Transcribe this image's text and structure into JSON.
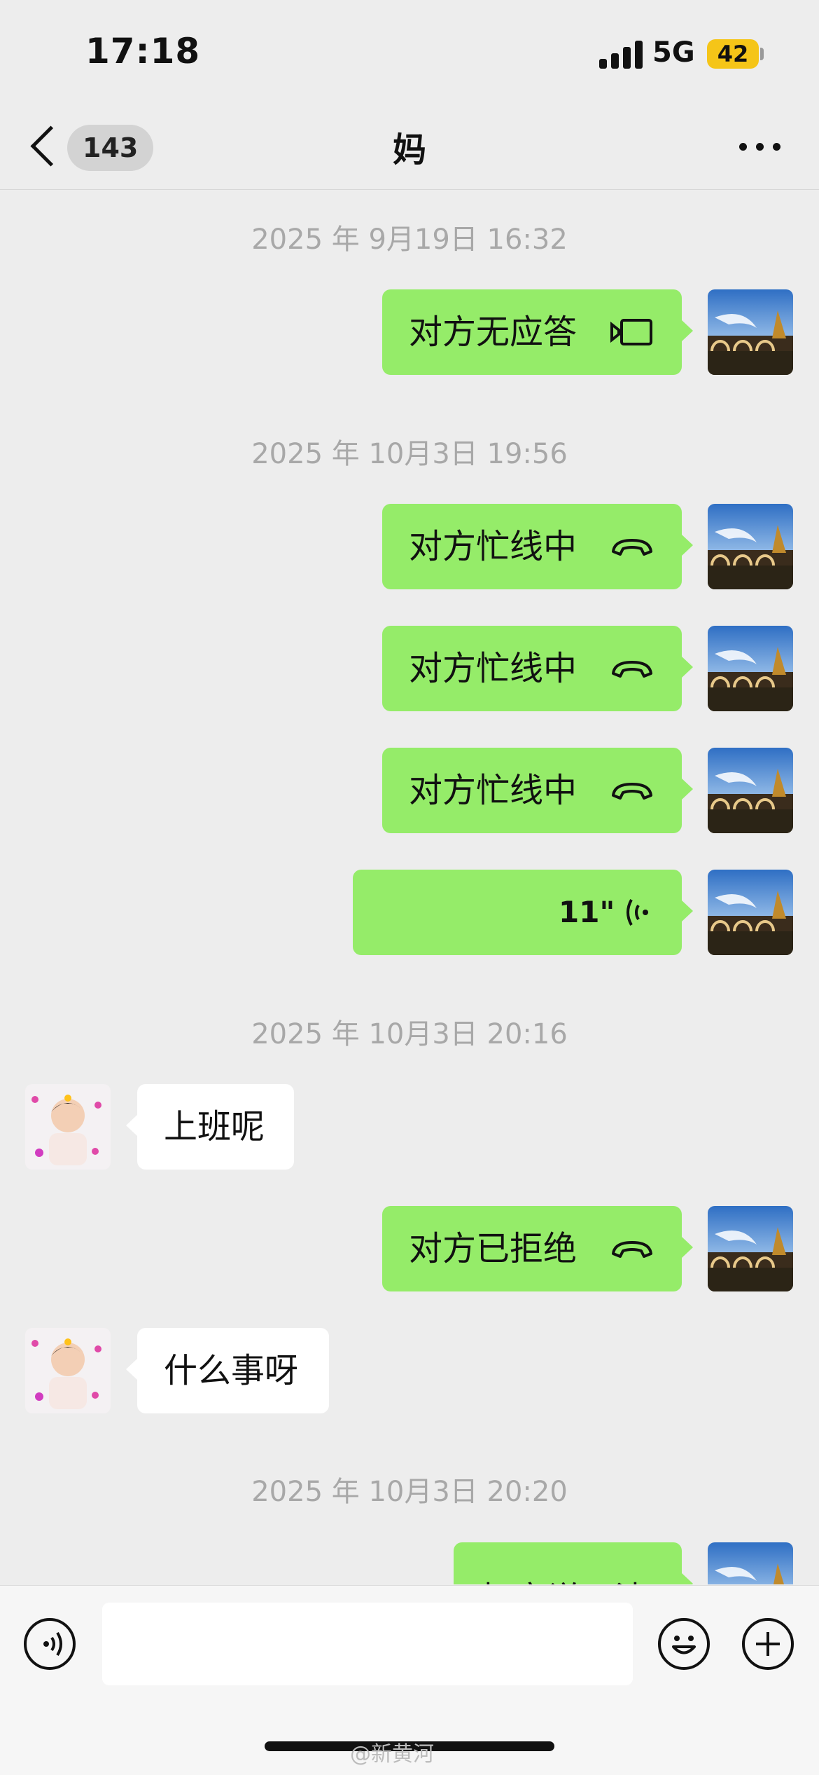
{
  "status_bar": {
    "time": "17:18",
    "network": "5G",
    "battery": "42"
  },
  "nav": {
    "unread_count": "143",
    "title": "妈"
  },
  "chat": {
    "timestamps": [
      "2025 年 9月19日 16:32",
      "2025 年 10月3日 19:56",
      "2025 年 10月3日 20:16",
      "2025 年 10月3日 20:20"
    ],
    "messages": [
      {
        "direction": "out",
        "text": "对方无应答",
        "icon": "video-call-icon"
      },
      {
        "direction": "out",
        "text": "对方忙线中",
        "icon": "hangup-phone-icon"
      },
      {
        "direction": "out",
        "text": "对方忙线中",
        "icon": "hangup-phone-icon"
      },
      {
        "direction": "out",
        "text": "对方忙线中",
        "icon": "hangup-phone-icon"
      },
      {
        "direction": "out",
        "text": "11\"",
        "icon": "voice-wave-icon"
      },
      {
        "direction": "in",
        "text": "上班呢"
      },
      {
        "direction": "out",
        "text": "对方已拒绝",
        "icon": "hangup-phone-icon"
      },
      {
        "direction": "in",
        "text": "什么事呀"
      },
      {
        "direction": "out",
        "text": "打字说不清",
        "icon": ""
      }
    ]
  },
  "input_bar": {
    "placeholder": "",
    "watermark": "@新黄河"
  },
  "colors": {
    "outgoing_bubble": "#95ec69",
    "incoming_bubble": "#ffffff",
    "background": "#ededed",
    "battery": "#f5c518"
  }
}
